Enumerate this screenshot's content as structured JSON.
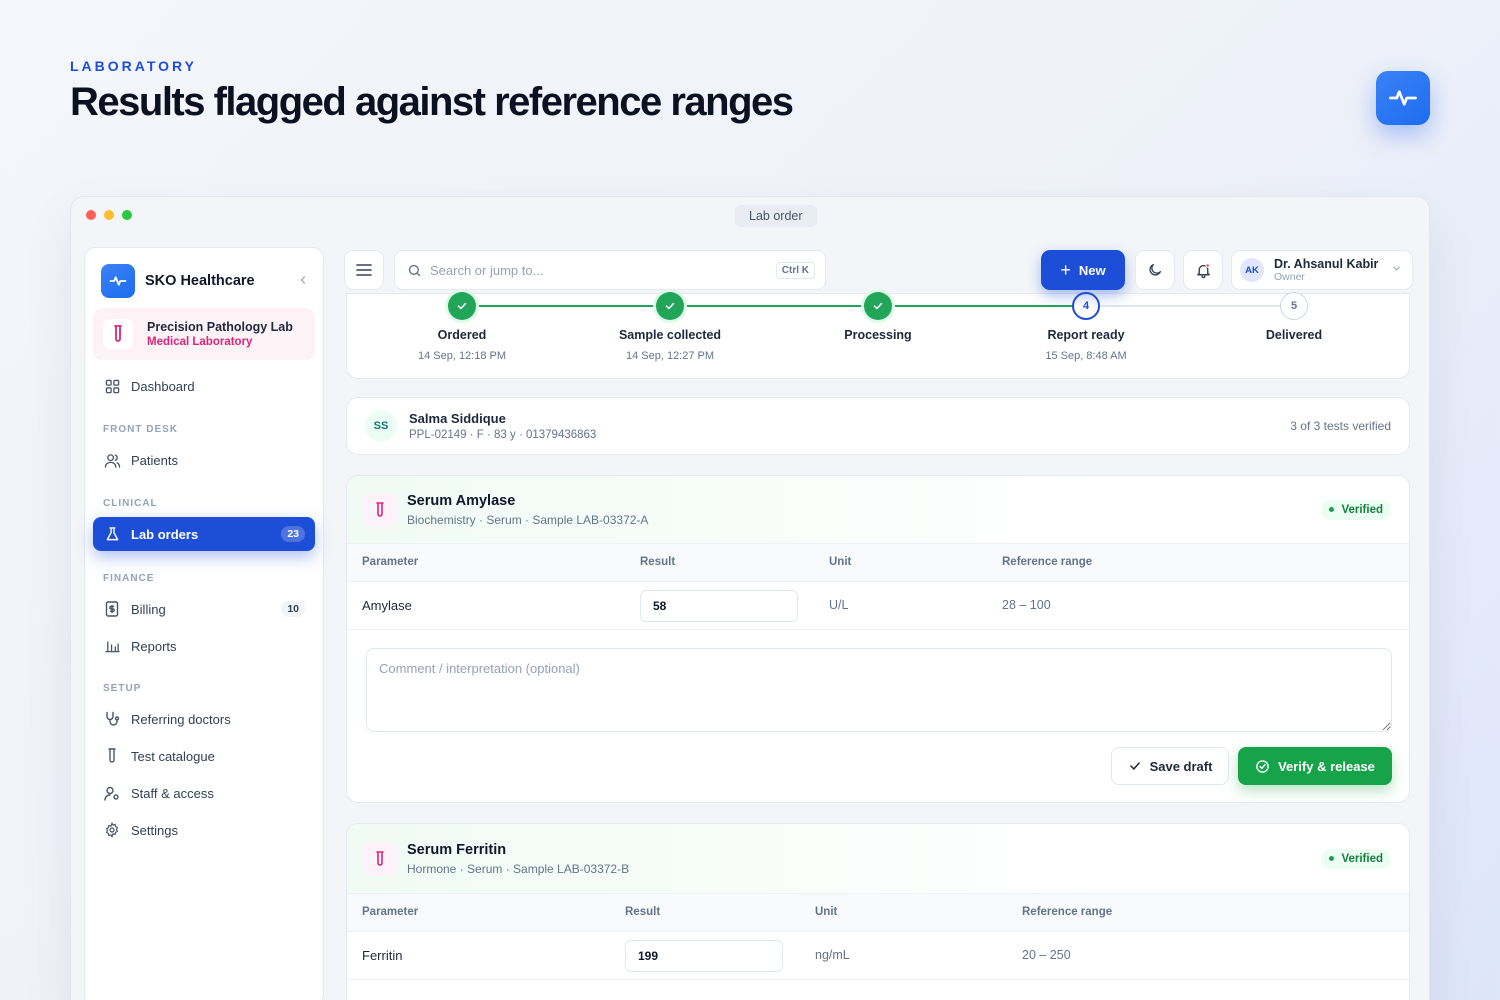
{
  "hero": {
    "kicker": "LABORATORY",
    "title": "Results flagged against reference ranges",
    "logo_icon": "pulse-icon"
  },
  "window": {
    "title": "Lab order"
  },
  "sidebar": {
    "brand_name": "SKO Healthcare",
    "lab_name": "Precision Pathology Lab",
    "lab_type": "Medical Laboratory",
    "items": [
      {
        "label": "Dashboard",
        "icon": "grid-icon"
      },
      {
        "label": "Patients",
        "icon": "users-icon"
      },
      {
        "label": "Lab orders",
        "icon": "flask-icon",
        "badge": "23",
        "active": true
      },
      {
        "label": "Billing",
        "icon": "invoice-icon",
        "badge": "10"
      },
      {
        "label": "Reports",
        "icon": "bar-chart-icon"
      },
      {
        "label": "Referring doctors",
        "icon": "stethoscope-icon"
      },
      {
        "label": "Test catalogue",
        "icon": "test-tube-icon"
      },
      {
        "label": "Staff & access",
        "icon": "user-key-icon"
      },
      {
        "label": "Settings",
        "icon": "gear-icon"
      }
    ],
    "sections": {
      "front_desk": "FRONT DESK",
      "clinical": "CLINICAL",
      "finance": "FINANCE",
      "setup": "SETUP"
    }
  },
  "topbar": {
    "search_placeholder": "Search or jump to...",
    "shortcut": "Ctrl K",
    "new_label": "New",
    "user_initials": "AK",
    "user_name": "Dr. Ahsanul Kabir",
    "user_role": "Owner"
  },
  "tracker": {
    "steps": [
      {
        "label": "Ordered",
        "time": "14 Sep, 12:18 PM",
        "status": "done"
      },
      {
        "label": "Sample collected",
        "time": "14 Sep, 12:27 PM",
        "status": "done"
      },
      {
        "label": "Processing",
        "time": "",
        "status": "done"
      },
      {
        "label": "Report ready",
        "time": "15 Sep, 8:48 AM",
        "status": "current",
        "number": "4"
      },
      {
        "label": "Delivered",
        "time": "",
        "status": "future",
        "number": "5"
      }
    ],
    "done_color": "#22a559",
    "current_color": "#1d4ed8"
  },
  "patient": {
    "initials": "SS",
    "name": "Salma Siddique",
    "meta": "PPL-02149 · F · 83 y · 01379436863",
    "verified_summary": "3 of 3 tests verified"
  },
  "tests": [
    {
      "name": "Serum Amylase",
      "subtitle": "Biochemistry · Serum · Sample LAB-03372-A",
      "status": "Verified",
      "columns": [
        "Parameter",
        "Result",
        "Unit",
        "Reference range"
      ],
      "rows": [
        {
          "parameter": "Amylase",
          "result": "58",
          "unit": "U/L",
          "range": "28 – 100"
        }
      ],
      "comment_placeholder": "Comment / interpretation (optional)",
      "save_label": "Save draft",
      "verify_label": "Verify & release"
    },
    {
      "name": "Serum Ferritin",
      "subtitle": "Hormone · Serum · Sample LAB-03372-B",
      "status": "Verified",
      "columns": [
        "Parameter",
        "Result",
        "Unit",
        "Reference range"
      ],
      "rows": [
        {
          "parameter": "Ferritin",
          "result": "199",
          "unit": "ng/mL",
          "range": "20 – 250"
        }
      ]
    }
  ],
  "colors": {
    "accent": "#1d4ed8",
    "success": "#16a34a",
    "lab_accent": "#db2777"
  }
}
